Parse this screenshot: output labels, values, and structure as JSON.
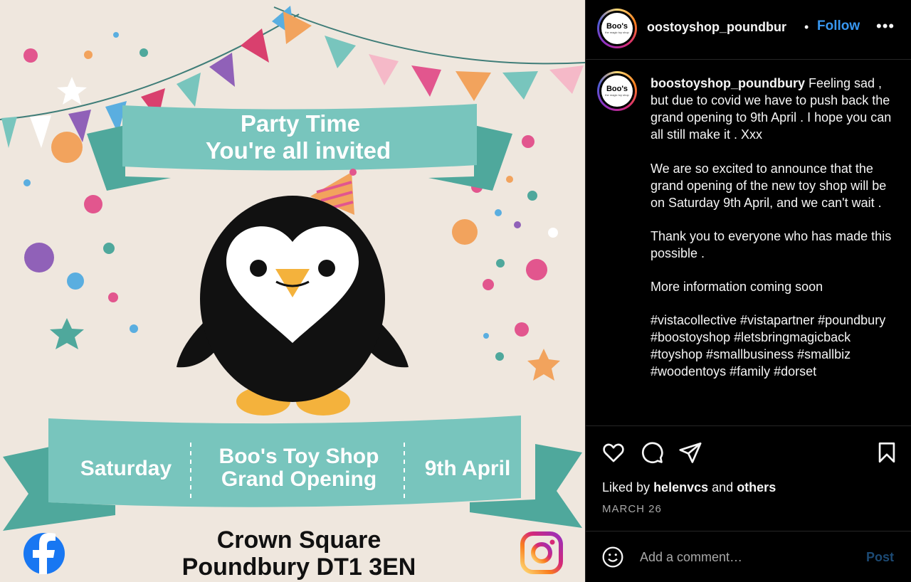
{
  "image": {
    "ribbon_title": "Party Time",
    "ribbon_subtitle": "You're all invited",
    "day": "Saturday",
    "shop_name": "Boo's Toy Shop",
    "shop_sub": "Grand Opening",
    "date": "9th April",
    "address_line1": "Crown Square",
    "address_line2": "Poundbury DT1 3EN",
    "icons": [
      "facebook-logo",
      "instagram-logo",
      "penguin-mascot",
      "party-hat",
      "bunting"
    ],
    "colors": {
      "background": "#efe7de",
      "ribbon": "#78c5bd",
      "ribbon_dark": "#4fa89c",
      "penguin": "#111111",
      "beak": "#f4b23c"
    }
  },
  "header": {
    "avatar_word": "Boo's",
    "avatar_tag": "the magic toy shop",
    "username": "oostoyshop_poundbur",
    "separator": "•",
    "follow_label": "Follow",
    "more_label": "•••"
  },
  "caption": {
    "username": "boostoyshop_poundbury",
    "paragraph1": "Feeling sad , but due to covid we have to push back the grand opening to 9th April . I hope you can all still make it . Xxx",
    "paragraph2": "We are so excited to announce that the grand opening of the new toy shop will be on Saturday 9th April, and we can't wait .",
    "paragraph3": "Thank you to everyone who has made this possible .",
    "paragraph4": "More information coming soon",
    "hashtags": "#vistacollective #vistapartner #poundbury #boostoyshop #letsbringmagicback #toyshop #smallbusiness #smallbiz #woodentoys #family #dorset"
  },
  "actions": {
    "liked_by_prefix": "Liked by",
    "liked_by_user": "helenvcs",
    "liked_by_and": "and",
    "liked_by_others": "others",
    "date": "MARCH 26",
    "icons": [
      "heart-icon",
      "comment-icon",
      "share-icon",
      "bookmark-icon"
    ]
  },
  "comment": {
    "placeholder": "Add a comment…",
    "post_label": "Post"
  }
}
